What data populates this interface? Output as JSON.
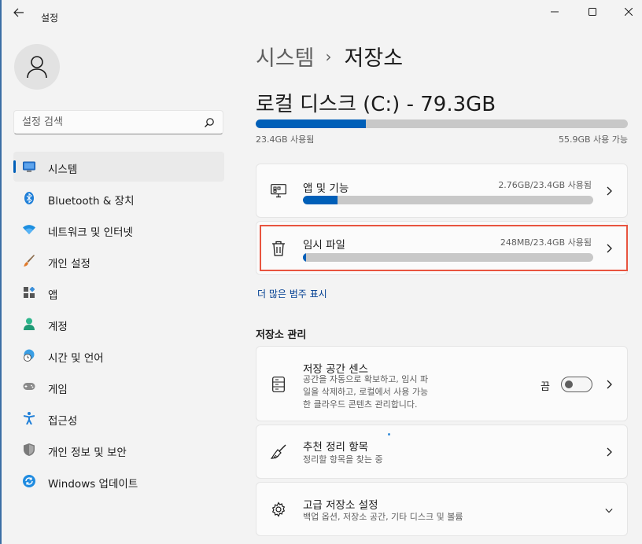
{
  "window": {
    "title": "설정",
    "controls": {
      "back": "back-arrow-icon",
      "minimize": "minimize-icon",
      "maximize": "maximize-icon",
      "close": "close-icon"
    }
  },
  "sidebar": {
    "search": {
      "placeholder": "설정 검색",
      "value": ""
    },
    "items": [
      {
        "label": "시스템",
        "icon": "monitor-icon",
        "active": true
      },
      {
        "label": "Bluetooth & 장치",
        "icon": "bluetooth-icon",
        "active": false
      },
      {
        "label": "네트워크 및 인터넷",
        "icon": "wifi-icon",
        "active": false
      },
      {
        "label": "개인 설정",
        "icon": "brush-icon",
        "active": false
      },
      {
        "label": "앱",
        "icon": "apps-icon",
        "active": false
      },
      {
        "label": "계정",
        "icon": "person-icon",
        "active": false
      },
      {
        "label": "시간 및 언어",
        "icon": "globe-clock-icon",
        "active": false
      },
      {
        "label": "게임",
        "icon": "gamepad-icon",
        "active": false
      },
      {
        "label": "접근성",
        "icon": "accessibility-icon",
        "active": false
      },
      {
        "label": "개인 정보 및 보안",
        "icon": "shield-icon",
        "active": false
      },
      {
        "label": "Windows 업데이트",
        "icon": "update-icon",
        "active": false
      }
    ]
  },
  "main": {
    "breadcrumb": {
      "parent": "시스템",
      "separator": "›",
      "current": "저장소"
    },
    "drive": {
      "title": "로컬 디스크 (C:) - 79.3GB",
      "used_label": "23.4GB 사용됨",
      "free_label": "55.9GB 사용 가능",
      "used_fraction": 0.295
    },
    "categories": [
      {
        "title": "앱 및 기능",
        "usage": "2.76GB/23.4GB 사용됨",
        "fraction": 0.118,
        "icon": "apps-features-icon"
      },
      {
        "title": "임시 파일",
        "usage": "248MB/23.4GB 사용됨",
        "fraction": 0.011,
        "icon": "trash-icon"
      }
    ],
    "more_link": "더 많은 범주 표시",
    "management": {
      "section_title": "저장소 관리",
      "storage_sense": {
        "title": "저장 공간 센스",
        "desc_lines": [
          "공간을 자동으로 확보하고, 임시 파",
          "일을 삭제하고, 로컬에서 사용 가능",
          "한 클라우드 콘텐츠 관리합니다."
        ],
        "toggle_label": "끔",
        "toggle_on": false,
        "icon": "drive-icon"
      },
      "cleanup": {
        "title": "추천 정리 항목",
        "desc": "정리할 항목을 찾는 중",
        "icon": "broom-icon"
      },
      "advanced": {
        "title": "고급 저장소 설정",
        "desc": "백업 옵션, 저장소 공간, 기타 디스크 및 볼륨",
        "icon": "gear-icon"
      }
    }
  },
  "colors": {
    "accent": "#005fb8",
    "highlight": "#e8543f",
    "background": "#f3f3f3"
  }
}
